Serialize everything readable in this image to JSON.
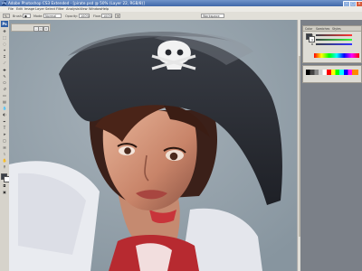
{
  "window": {
    "title": "Adobe Photoshop CS3 Extended - [pirate.psd @ 50% (Layer 22, RGB/8)]",
    "app_icon": "Ps"
  },
  "menu": [
    "File",
    "Edit",
    "Image",
    "Layer",
    "Select",
    "Filter",
    "Analysis",
    "View",
    "Window",
    "Help"
  ],
  "options_bar": {
    "mode_label": "Mode:",
    "mode_value": "Normal",
    "opacity_label": "Opacity:",
    "opacity_value": "100%",
    "flow_label": "Flow:",
    "flow_value": "100%",
    "workspace_value": "Workspace"
  },
  "panels": {
    "color_tabs": [
      "Color",
      "Swatches",
      "Styles"
    ],
    "sliders": [
      {
        "label": "R",
        "value": 0.45
      },
      {
        "label": "G",
        "value": 0.45
      },
      {
        "label": "B",
        "value": 0.45
      }
    ],
    "colors": {
      "foreground": "#3a3f47",
      "background": "#ffffff",
      "accent_red": "#d1242b"
    }
  },
  "toolbox_logo": "Ps"
}
